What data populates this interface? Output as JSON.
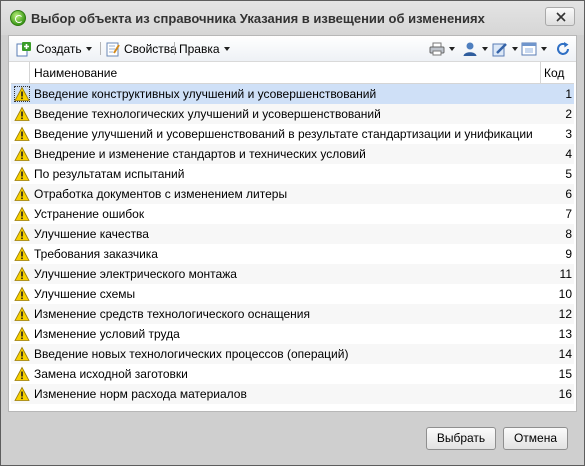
{
  "window": {
    "title": "Выбор объекта из справочника Указания в извещении об изменениях"
  },
  "toolbar": {
    "create_label": "Создать",
    "properties_label": "Свойства",
    "edit_label": "Правка"
  },
  "grid": {
    "columns": {
      "name": "Наименование",
      "code": "Код"
    },
    "rows": [
      {
        "name": "Введение конструктивных улучшений и усовершенствований",
        "code": "1"
      },
      {
        "name": "Введение технологических улучшений и усовершенствований",
        "code": "2"
      },
      {
        "name": "Введение улучшений и усовершенствований в результате стандартизации и унификации",
        "code": "3"
      },
      {
        "name": "Внедрение и изменение стандартов и технических условий",
        "code": "4"
      },
      {
        "name": "По результатам испытаний",
        "code": "5"
      },
      {
        "name": "Отработка документов с изменением литеры",
        "code": "6"
      },
      {
        "name": "Устранение ошибок",
        "code": "7"
      },
      {
        "name": "Улучшение качества",
        "code": "8"
      },
      {
        "name": "Требования заказчика",
        "code": "9"
      },
      {
        "name": "Улучшение электрического монтажа",
        "code": "11"
      },
      {
        "name": "Улучшение схемы",
        "code": "10"
      },
      {
        "name": "Изменение средств технологического оснащения",
        "code": "12"
      },
      {
        "name": "Изменение условий труда",
        "code": "13"
      },
      {
        "name": "Введение новых технологических процессов (операций)",
        "code": "14"
      },
      {
        "name": "Замена исходной заготовки",
        "code": "15"
      },
      {
        "name": "Изменение норм расхода материалов",
        "code": "16"
      }
    ]
  },
  "buttons": {
    "select": "Выбрать",
    "cancel": "Отмена"
  },
  "colors": {
    "selected_row": "#cfe0f7",
    "warning": "#f5d000"
  }
}
